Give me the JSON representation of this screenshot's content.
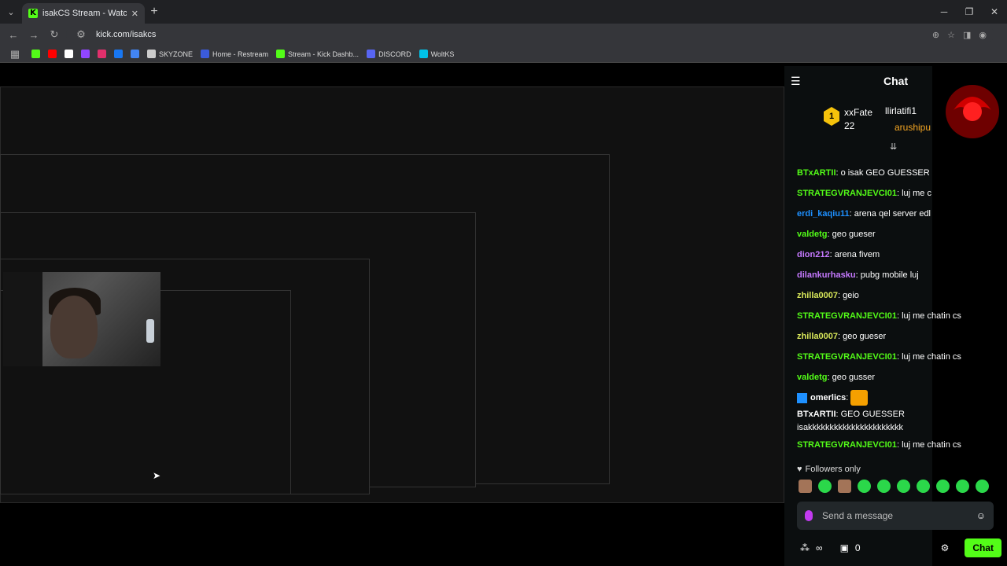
{
  "browser": {
    "tab_title": "isakCS Stream - Watch Live on K",
    "url": "kick.com/isakcs",
    "bookmarks": [
      "SKYZONE",
      "Home - Restream",
      "Stream - Kick Dashb...",
      "DISCORD",
      "WoltKS"
    ]
  },
  "chat": {
    "title": "Chat",
    "pinned": {
      "user1": "xxFate",
      "count": "22",
      "user2": "llirlatifi1",
      "user3": "arushipu"
    },
    "messages": [
      {
        "user": "BTxARTII",
        "text": "o isak GEO GUESSER",
        "color": "g"
      },
      {
        "user": "STRATEGVRANJEVCI01",
        "text": "luj me c",
        "color": "g"
      },
      {
        "user": "erdi_kaqiu11",
        "text": "arena qel server edl",
        "color": "b"
      },
      {
        "user": "valdetg",
        "text": "geo gueser",
        "color": "g"
      },
      {
        "user": "dion212",
        "text": "arena fivem",
        "color": "p"
      },
      {
        "user": "dilankurhasku",
        "text": "pubg mobile luj",
        "color": "p"
      },
      {
        "user": "zhilla0007",
        "text": "geio",
        "color": "y"
      },
      {
        "user": "STRATEGVRANJEVCI01",
        "text": "luj me chatin cs",
        "color": "g"
      },
      {
        "user": "zhilla0007",
        "text": "geo gueser",
        "color": "y"
      },
      {
        "user": "STRATEGVRANJEVCI01",
        "text": "luj me chatin cs",
        "color": "g"
      },
      {
        "user": "valdetg",
        "text": "geo gusser",
        "color": "g"
      },
      {
        "user": "omerlics",
        "text": "",
        "color": "w"
      },
      {
        "user": "BTxARTII",
        "text": "GEO GUESSER",
        "color": "w"
      },
      {
        "user": "",
        "text": "isakkkkkkkkkkkkkkkkkkkkkk",
        "color": "w"
      },
      {
        "user": "STRATEGVRANJEVCI01",
        "text": "luj me chatin cs",
        "color": "g"
      }
    ],
    "followers_only": "Followers only",
    "input_placeholder": "Send a message",
    "footer_count_inf": "∞",
    "footer_count_zero": "0",
    "send_label": "Chat"
  },
  "colors": {
    "accent": "#53fc18",
    "chat_bg": "#0b0e0f"
  },
  "icons": [
    "back-icon",
    "forward-icon",
    "reload-icon",
    "star-icon",
    "gear-icon",
    "smile-icon",
    "mic-icon"
  ]
}
